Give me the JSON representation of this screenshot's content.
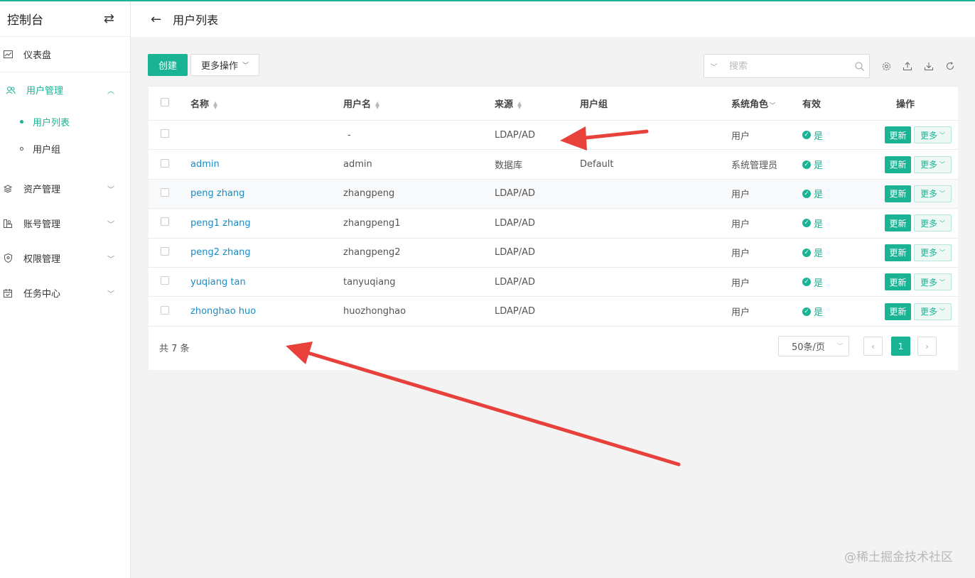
{
  "sidebar": {
    "title": "控制台",
    "toggle_icon": "swap-icon",
    "items": [
      {
        "label": "仪表盘",
        "icon": "dashboard-icon"
      },
      {
        "label": "用户管理",
        "icon": "users-icon",
        "active": true
      },
      {
        "label": "资产管理",
        "icon": "layers-icon"
      },
      {
        "label": "账号管理",
        "icon": "account-icon"
      },
      {
        "label": "权限管理",
        "icon": "shield-icon"
      },
      {
        "label": "任务中心",
        "icon": "calendar-icon"
      }
    ],
    "sub_items": [
      {
        "label": "用户列表",
        "active": true
      },
      {
        "label": "用户组"
      }
    ]
  },
  "header": {
    "title": "用户列表"
  },
  "toolbar": {
    "create_label": "创建",
    "more_label": "更多操作",
    "search_placeholder": "搜索"
  },
  "table": {
    "columns": [
      "名称",
      "用户名",
      "来源",
      "用户组",
      "系统角色",
      "有效",
      "操作"
    ],
    "rows": [
      {
        "name": "",
        "username": "-",
        "source": "LDAP/AD",
        "group": "",
        "role": "用户",
        "valid": "是"
      },
      {
        "name": "admin",
        "username": "admin",
        "source": "数据库",
        "group": "Default",
        "role": "系统管理员",
        "valid": "是"
      },
      {
        "name": "peng zhang",
        "username": "zhangpeng",
        "source": "LDAP/AD",
        "group": "",
        "role": "用户",
        "valid": "是"
      },
      {
        "name": "peng1 zhang",
        "username": "zhangpeng1",
        "source": "LDAP/AD",
        "group": "",
        "role": "用户",
        "valid": "是"
      },
      {
        "name": "peng2 zhang",
        "username": "zhangpeng2",
        "source": "LDAP/AD",
        "group": "",
        "role": "用户",
        "valid": "是"
      },
      {
        "name": "yuqiang tan",
        "username": "tanyuqiang",
        "source": "LDAP/AD",
        "group": "",
        "role": "用户",
        "valid": "是"
      },
      {
        "name": "zhonghao huo",
        "username": "huozhonghao",
        "source": "LDAP/AD",
        "group": "",
        "role": "用户",
        "valid": "是"
      }
    ],
    "update_label": "更新",
    "more_label": "更多"
  },
  "pagination": {
    "total_text": "共 7 条",
    "page_size": "50条/页",
    "current_page": "1",
    "prev": "‹",
    "next": "›"
  },
  "watermark": "@稀土掘金技术社区",
  "colors": {
    "accent": "#1ab394",
    "link": "#1a8dc4",
    "annotation": "#e8413c"
  }
}
